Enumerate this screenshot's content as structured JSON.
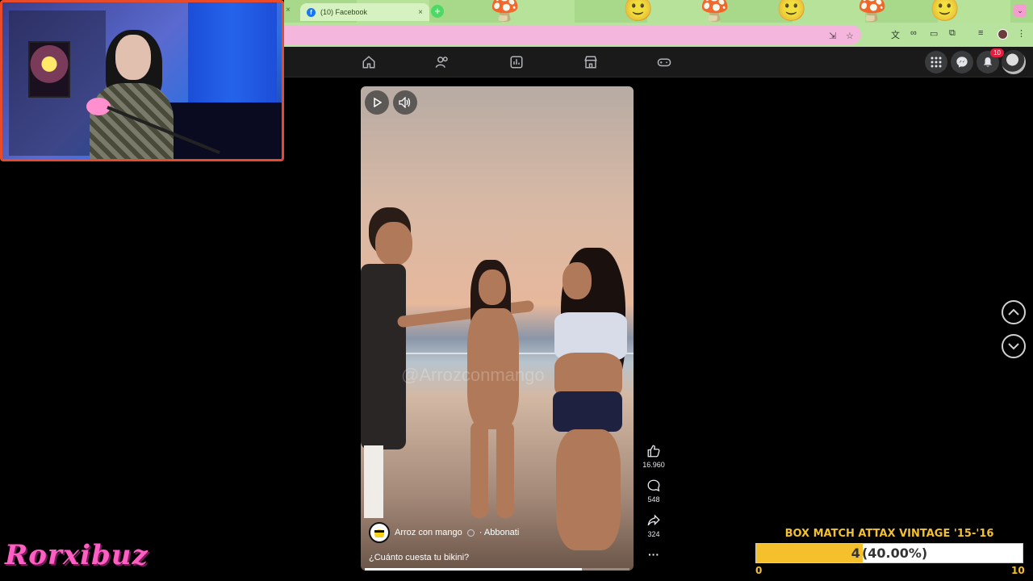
{
  "browser": {
    "tab_title": "(10) Facebook",
    "favicon_letter": "f",
    "new_tab_glyph": "+",
    "close_glyph": "×"
  },
  "fb_nav": {
    "notification_count": "10",
    "icons": [
      "home-icon",
      "friends-icon",
      "dashboard-icon",
      "marketplace-icon",
      "gaming-icon",
      "menu-grid-icon",
      "messenger-icon",
      "bell-icon"
    ]
  },
  "video": {
    "watermark": "@Arrozconmango",
    "author_name": "Arroz con mango",
    "subscribe_label": "· Abbonati",
    "caption": "¿Cuánto cuesta tu bikini?",
    "progress": 0.82
  },
  "reactions": {
    "likes": "16.960",
    "comments": "548",
    "shares": "324",
    "more_glyph": "···"
  },
  "stream_overlay": {
    "brand": "Rorxibuz",
    "goal_title": "BOX MATCH ATTAX VINTAGE '15-'16",
    "goal_current": "4",
    "goal_percent": "(40.00%)",
    "goal_fraction": 0.4,
    "goal_min": "0",
    "goal_max": "10",
    "colors": {
      "goal_gold": "#f4c12d",
      "brand_pink": "#ff5fc2",
      "webcam_border": "#e84a2a"
    }
  }
}
